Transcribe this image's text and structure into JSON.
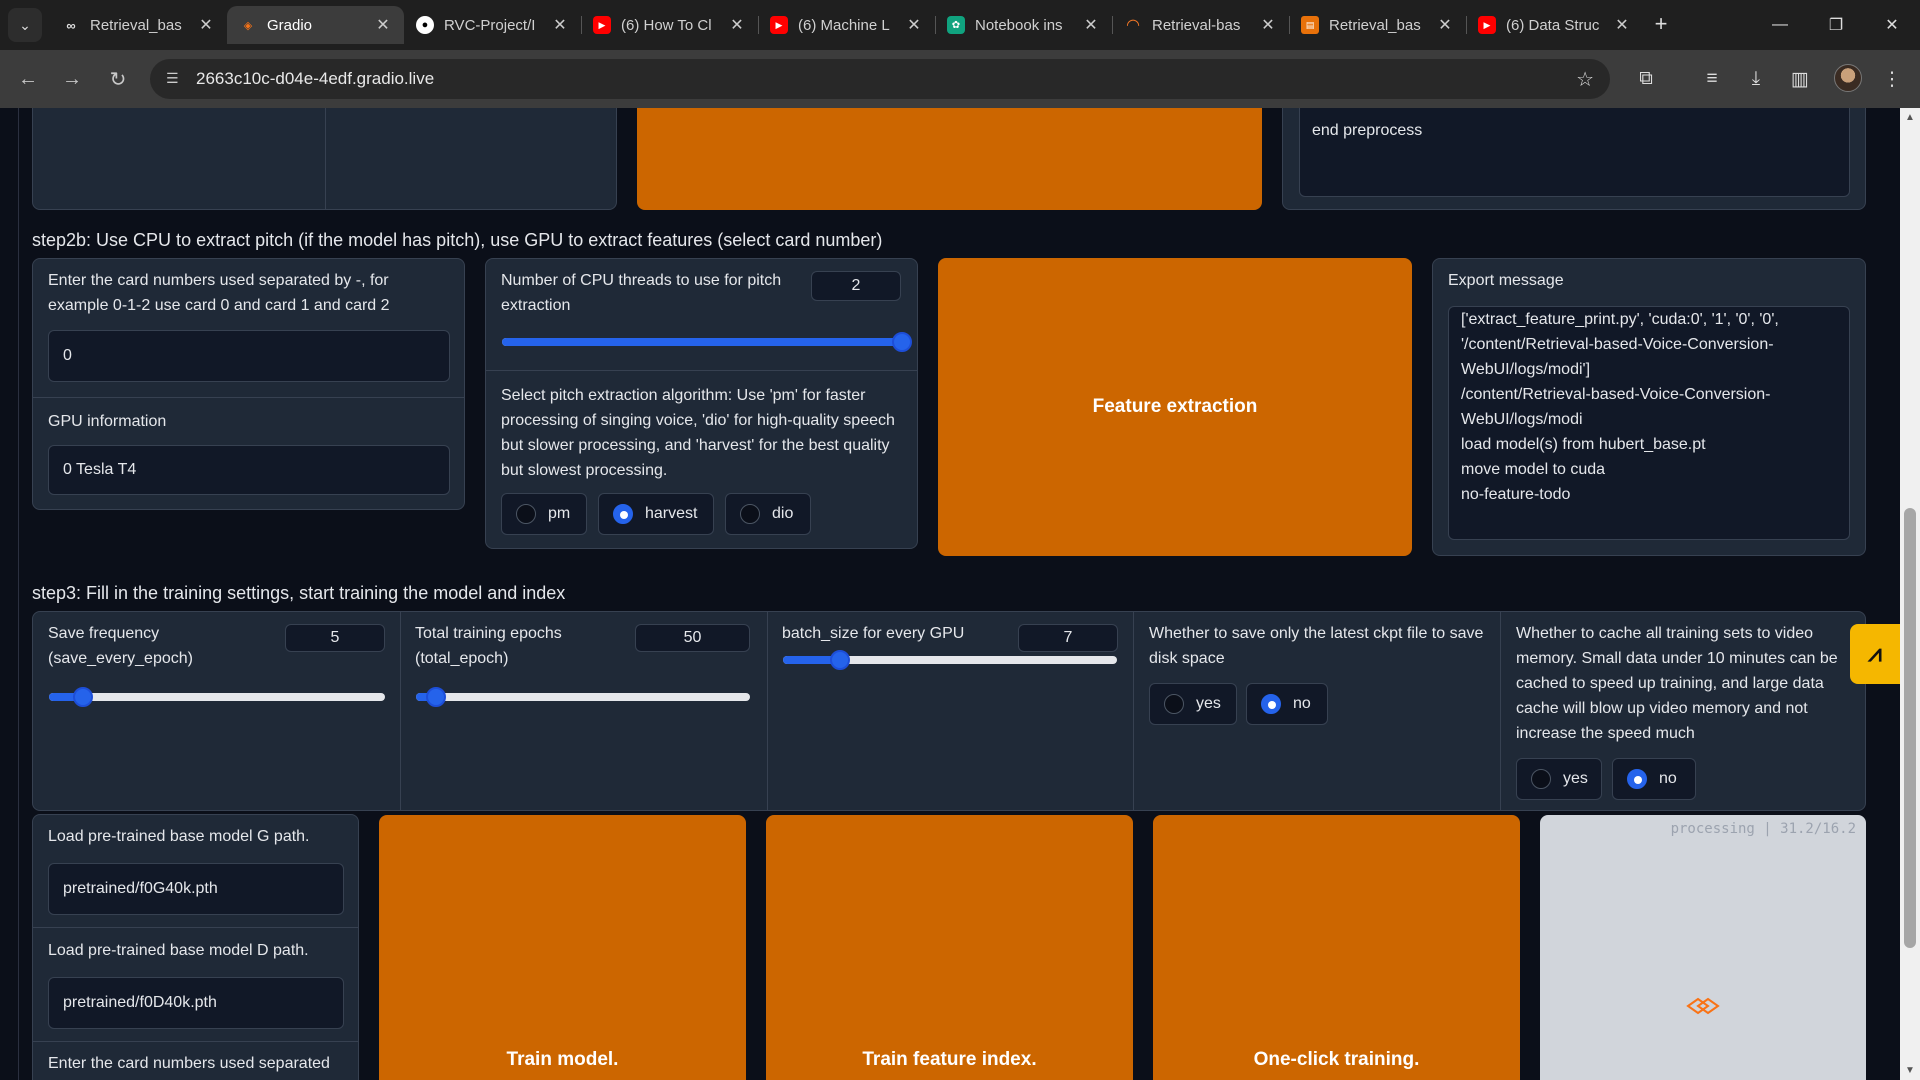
{
  "browser": {
    "tabs": [
      {
        "label": "Retrieval_bas",
        "icon": "colab-icon",
        "active": false
      },
      {
        "label": "Gradio",
        "icon": "gradio-icon",
        "active": true
      },
      {
        "label": "RVC-Project/I",
        "icon": "github-icon",
        "active": false
      },
      {
        "label": "(6) How To Cl",
        "icon": "youtube-icon",
        "active": false
      },
      {
        "label": "(6) Machine L",
        "icon": "youtube-icon",
        "active": false
      },
      {
        "label": "Notebook ins",
        "icon": "chatgpt-icon",
        "active": false
      },
      {
        "label": "Retrieval-bas",
        "icon": "jupyter-icon",
        "active": false
      },
      {
        "label": "Retrieval_bas",
        "icon": "notebook-icon",
        "active": false
      },
      {
        "label": "(6) Data Struc",
        "icon": "youtube-icon",
        "active": false
      }
    ],
    "url": "2663c10c-d04e-4edf.gradio.live"
  },
  "top": {
    "preprocess_output": "end preprocess"
  },
  "step2b": {
    "title": "step2b: Use CPU to extract pitch (if the model has pitch), use GPU to extract features (select card number)",
    "card_label": "Enter the card numbers used separated by -, for example 0-1-2 use card 0 and card 1 and card 2",
    "card_value": "0",
    "gpu_info_label": "GPU information",
    "gpu_info_value": "0 Tesla T4",
    "cpu_threads_label": "Number of CPU threads to use for pitch extraction",
    "cpu_threads_value": "2",
    "cpu_threads_slider_fraction": 1.0,
    "algo_label": "Select pitch extraction algorithm: Use 'pm' for faster processing of singing voice, 'dio' for high-quality speech but slower processing, and 'harvest' for the best quality but slowest processing.",
    "algo_options": [
      "pm",
      "harvest",
      "dio"
    ],
    "algo_selected": "harvest",
    "extract_button": "Feature extraction",
    "export_label": "Export message",
    "export_message": "['extract_feature_print.py', 'cuda:0', '1', '0', '0', '/content/Retrieval-based-Voice-Conversion-WebUI/logs/modi']\n/content/Retrieval-based-Voice-Conversion-WebUI/logs/modi\nload model(s) from hubert_base.pt\nmove model to cuda\nno-feature-todo"
  },
  "step3": {
    "title": "step3: Fill in the training settings, start training the model and index",
    "save_freq_label": "Save frequency (save_every_epoch)",
    "save_freq_value": "5",
    "save_freq_fraction": 0.1,
    "epochs_label": "Total training epochs (total_epoch)",
    "epochs_value": "50",
    "epochs_fraction": 0.06,
    "batch_label": "batch_size for every GPU",
    "batch_value": "7",
    "batch_fraction": 0.17,
    "save_latest_label": "Whether to save only the latest ckpt file to save disk space",
    "save_latest_options": [
      "yes",
      "no"
    ],
    "save_latest_selected": "no",
    "cache_label": "Whether to cache all training sets to video memory. Small data under 10 minutes can be cached to speed up training, and large data cache will blow up video memory and not increase the speed much",
    "cache_options": [
      "yes",
      "no"
    ],
    "cache_selected": "no",
    "pretrained_g_label": "Load pre-trained base model G path.",
    "pretrained_g_value": "pretrained/f0G40k.pth",
    "pretrained_d_label": "Load pre-trained base model D path.",
    "pretrained_d_value": "pretrained/f0D40k.pth",
    "card_numbers_label": "Enter the card numbers used separated",
    "train_model_button": "Train model.",
    "train_index_button": "Train feature index.",
    "one_click_button": "One-click training.",
    "processing_text": "processing | 31.2/16.2"
  },
  "colors": {
    "accent_orange": "#cc6600",
    "primary_blue": "#2563eb",
    "panel": "#1f2937",
    "background": "#0b0f19"
  }
}
